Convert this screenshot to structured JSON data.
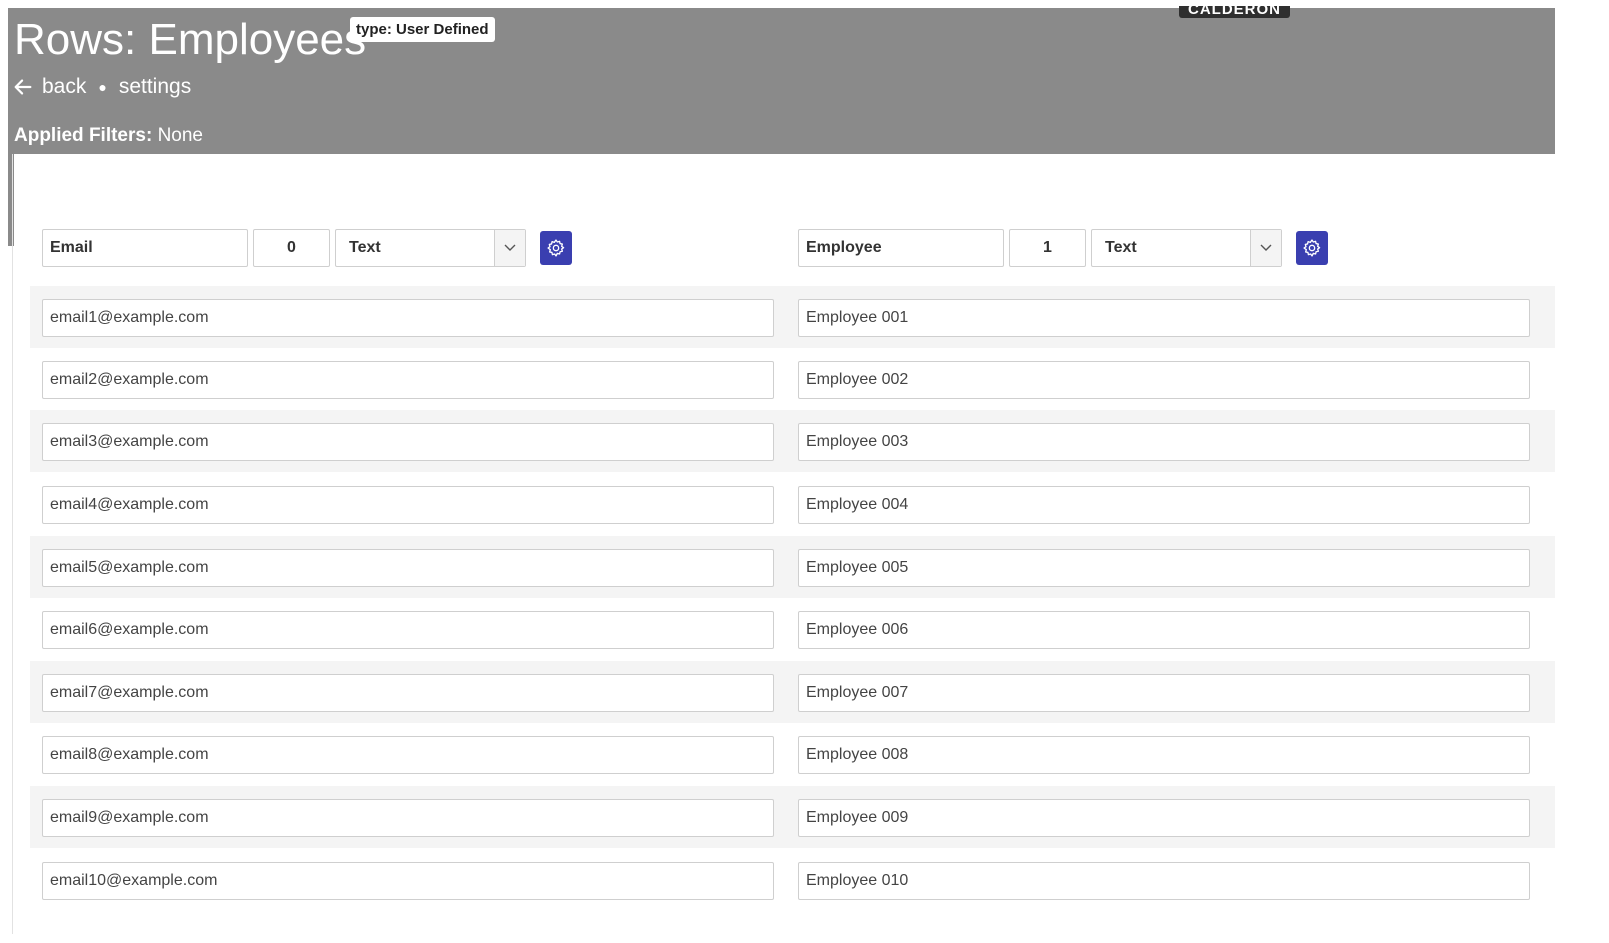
{
  "header": {
    "title": "Rows: Employees",
    "type_badge": "type: User Defined",
    "brand_tab": "CALDERON",
    "nav": {
      "back_label": "back",
      "settings_label": "settings"
    },
    "filters": {
      "label": "Applied Filters:",
      "value": "None"
    }
  },
  "columns": [
    {
      "name": "Email",
      "index": "0",
      "type": "Text"
    },
    {
      "name": "Employee",
      "index": "1",
      "type": "Text"
    }
  ],
  "rows": [
    [
      "email1@example.com",
      "Employee 001"
    ],
    [
      "email2@example.com",
      "Employee 002"
    ],
    [
      "email3@example.com",
      "Employee 003"
    ],
    [
      "email4@example.com",
      "Employee 004"
    ],
    [
      "email5@example.com",
      "Employee 005"
    ],
    [
      "email6@example.com",
      "Employee 006"
    ],
    [
      "email7@example.com",
      "Employee 007"
    ],
    [
      "email8@example.com",
      "Employee 008"
    ],
    [
      "email9@example.com",
      "Employee 009"
    ],
    [
      "email10@example.com",
      "Employee 010"
    ]
  ],
  "colors": {
    "header_bg": "#8a8a8a",
    "gear_button": "#3a3fb0",
    "row_alt": "#f4f4f4"
  }
}
